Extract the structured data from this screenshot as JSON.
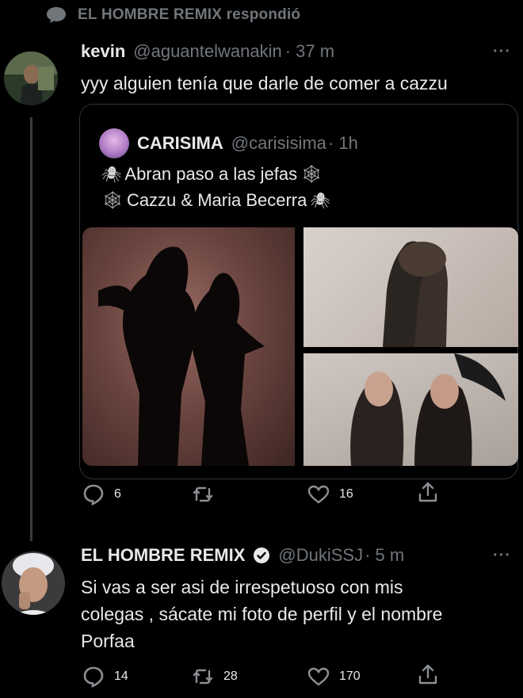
{
  "reply_header": {
    "label": "EL HOMBRE REMIX respondió"
  },
  "tweet1": {
    "name": "kevin",
    "handle": "@aguantelwanakin",
    "time": "· 37 m",
    "text": "yyy alguien tenía que darle de comer a cazzu",
    "quote": {
      "name": "CARISIMA",
      "handle": "@carisisima",
      "time": "· 1h",
      "line1": "Abran paso a las jefas",
      "line2": "Cazzu & Maria Becerra",
      "spider": "🕷",
      "web": "🕸"
    },
    "actions": {
      "replies": "6",
      "retweets": "",
      "likes": "16"
    }
  },
  "tweet2": {
    "name": "EL HOMBRE REMIX",
    "handle": "@DukiSSJ",
    "time": "· 5 m",
    "text_lines": [
      "Si vas a ser asi de irrespetuoso con mis",
      "colegas , sácate mi foto de perfil y el nombre",
      "Porfaa"
    ],
    "actions": {
      "replies": "14",
      "retweets": "28",
      "likes": "170"
    }
  },
  "more_label": "···",
  "colors": {
    "background": "#000000",
    "text": "#e7e9ea",
    "muted": "#71767b",
    "border": "#2f3336"
  }
}
